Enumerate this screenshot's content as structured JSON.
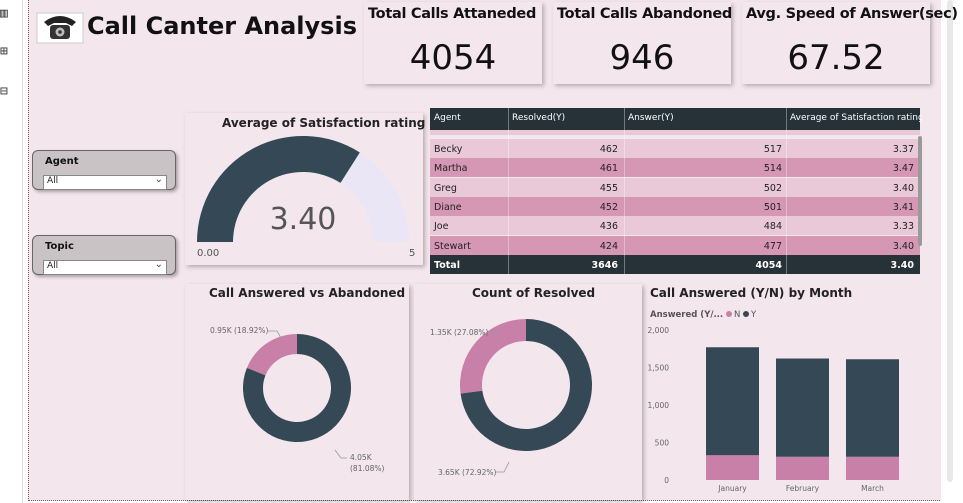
{
  "page": {
    "title": "Call Canter Analysis",
    "icon": "telephone-icon"
  },
  "kpis": [
    {
      "label": "Total Calls Attaneded",
      "value": "4054"
    },
    {
      "label": "Total Calls Abandoned",
      "value": "946"
    },
    {
      "label": "Avg. Speed of Answer(sec)",
      "value": "67.52"
    }
  ],
  "slicers": [
    {
      "label": "Agent",
      "value": "All"
    },
    {
      "label": "Topic",
      "value": "All"
    }
  ],
  "gauge": {
    "title": "Average of Satisfaction rating",
    "value_text": "3.40",
    "min_text": "0.00",
    "max_text": "5",
    "value": 3.4,
    "min": 0,
    "max": 5
  },
  "table": {
    "headers": [
      "Agent",
      "Resolved(Y)",
      "Answer(Y)",
      "Average of Satisfaction rating"
    ],
    "rows": [
      [
        "Becky",
        "462",
        "517",
        "3.37"
      ],
      [
        "Martha",
        "461",
        "514",
        "3.47"
      ],
      [
        "Greg",
        "455",
        "502",
        "3.40"
      ],
      [
        "Diane",
        "452",
        "501",
        "3.41"
      ],
      [
        "Joe",
        "436",
        "484",
        "3.33"
      ],
      [
        "Stewart",
        "424",
        "477",
        "3.40"
      ]
    ],
    "total": [
      "Total",
      "3646",
      "4054",
      "3.40"
    ]
  },
  "donut1": {
    "title": "Call Answered vs Abandoned",
    "label_small": "0.95K (18.92%)",
    "label_big_1": "4.05K",
    "label_big_2": "(81.08%)"
  },
  "donut2": {
    "title": "Count of Resolved",
    "label_small": "1.35K (27.08%)",
    "label_big": "3.65K (72.92%)"
  },
  "bar": {
    "title": "Call Answered (Y/N) by Month",
    "legend_title": "Answered (Y/...",
    "legend_n": "N",
    "legend_y": "Y"
  },
  "colors": {
    "dark": "#344955",
    "pink": "#c880a8",
    "gauge_track": "#eae6f5"
  },
  "chart_data": [
    {
      "type": "gauge",
      "title": "Average of Satisfaction rating",
      "value": 3.4,
      "min": 0,
      "max": 5
    },
    {
      "type": "pie",
      "title": "Call Answered vs Abandoned",
      "categories": [
        "N",
        "Y"
      ],
      "values": [
        946,
        4054
      ],
      "labels": [
        "0.95K (18.92%)",
        "4.05K (81.08%)"
      ]
    },
    {
      "type": "pie",
      "title": "Count of Resolved",
      "categories": [
        "N",
        "Y"
      ],
      "values": [
        1354,
        3646
      ],
      "labels": [
        "1.35K (27.08%)",
        "3.65K (72.92%)"
      ]
    },
    {
      "type": "bar",
      "title": "Call Answered (Y/N) by Month",
      "categories": [
        "January",
        "February",
        "March"
      ],
      "series": [
        {
          "name": "N",
          "values": [
            330,
            310,
            310
          ]
        },
        {
          "name": "Y",
          "values": [
            1440,
            1310,
            1300
          ]
        }
      ],
      "ylim": [
        0,
        2000
      ],
      "yticks": [
        "0",
        "500",
        "1,000",
        "1,500",
        "2,000"
      ],
      "legend": "top-left",
      "grid": false
    }
  ]
}
